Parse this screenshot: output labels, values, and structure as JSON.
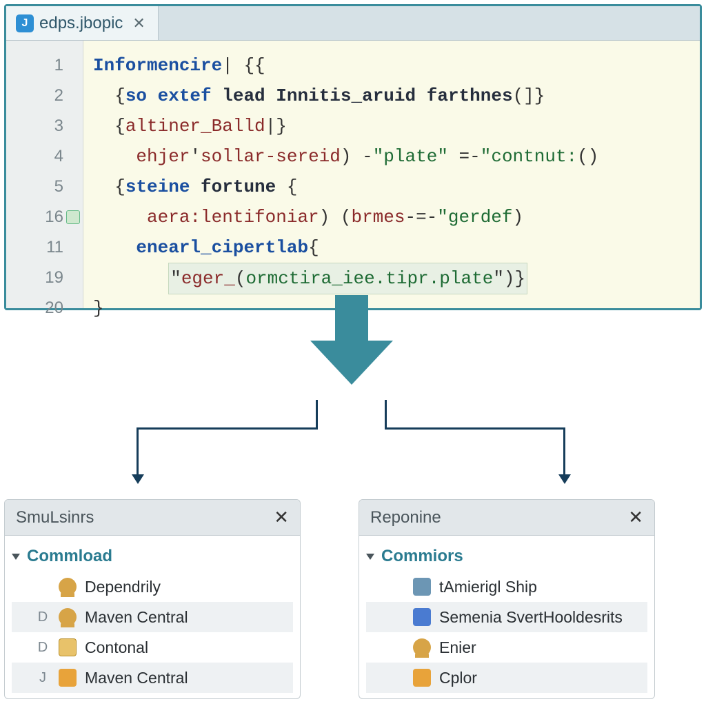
{
  "editor": {
    "tab": {
      "filename": "edps.jbopic"
    },
    "lines": [
      {
        "num": "1",
        "tokens": [
          [
            "kw",
            "Informencire"
          ],
          [
            "pl",
            "| {{"
          ]
        ]
      },
      {
        "num": "2",
        "tokens": [
          [
            "pl",
            "  {"
          ],
          [
            "kw",
            "so extef"
          ],
          [
            "pl",
            " "
          ],
          [
            "nm",
            "lead"
          ],
          [
            "pl",
            " "
          ],
          [
            "nm",
            "Innitis_aruid"
          ],
          [
            "pl",
            " "
          ],
          [
            "nm",
            "farthnes"
          ],
          [
            "pl",
            "(]}"
          ]
        ]
      },
      {
        "num": "3",
        "tokens": [
          [
            "pl",
            "  {"
          ],
          [
            "mt",
            "altiner_Balld"
          ],
          [
            "pl",
            "|}"
          ]
        ]
      },
      {
        "num": "4",
        "tokens": [
          [
            "pl",
            "    "
          ],
          [
            "mt",
            "ehjer"
          ],
          [
            "pl",
            "'"
          ],
          [
            "mt",
            "sollar-sereid"
          ],
          [
            "pl",
            ") -"
          ],
          [
            "st",
            "\"plate\""
          ],
          [
            "pl",
            " =-"
          ],
          [
            "st",
            "\"contnut:"
          ],
          [
            "pl",
            "()"
          ]
        ]
      },
      {
        "num": "5",
        "tokens": [
          [
            "pl",
            "  {"
          ],
          [
            "kw",
            "steine"
          ],
          [
            "pl",
            " "
          ],
          [
            "nm",
            "fortune"
          ],
          [
            "pl",
            " {"
          ]
        ]
      },
      {
        "num": "16",
        "tokens": [
          [
            "pl",
            "     "
          ],
          [
            "mt",
            "aera:lentifoniar"
          ],
          [
            "pl",
            ") ("
          ],
          [
            "mt",
            "brmes"
          ],
          [
            "pl",
            "-=-"
          ],
          [
            "st",
            "\"gerdef"
          ],
          [
            "pl",
            ")"
          ]
        ],
        "mark": true
      },
      {
        "num": "11",
        "tokens": [
          [
            "pl",
            "    "
          ],
          [
            "kw",
            "enearl_cipertlab"
          ],
          [
            "pl",
            "{"
          ]
        ]
      },
      {
        "num": "19",
        "tokens_hl": [
          [
            "pl",
            "\""
          ],
          [
            "mt",
            "eger_"
          ],
          [
            "pl",
            "("
          ],
          [
            "st",
            "ormctira_iee.tipr.plate"
          ],
          [
            "pl",
            "\")}"
          ]
        ],
        "indent": "       "
      },
      {
        "num": "20",
        "tokens": [
          [
            "pl",
            "}"
          ]
        ]
      }
    ]
  },
  "panels": {
    "left": {
      "title": "SmuLsinrs",
      "root": "Commload",
      "items": [
        {
          "badge": "",
          "icon": "person",
          "label": "Dependrily"
        },
        {
          "badge": "D",
          "icon": "person",
          "label": "Maven Central"
        },
        {
          "badge": "D",
          "icon": "doc",
          "label": "Contonal"
        },
        {
          "badge": "J",
          "icon": "folder",
          "label": "Maven Central"
        }
      ]
    },
    "right": {
      "title": "Reponine",
      "root": "Commiors",
      "items": [
        {
          "badge": "",
          "icon": "db",
          "label": "tAmierigl Ship"
        },
        {
          "badge": "",
          "icon": "card",
          "label": "Semenia SvertHooldesrits"
        },
        {
          "badge": "",
          "icon": "person",
          "label": "Enier"
        },
        {
          "badge": "",
          "icon": "folder",
          "label": "Cplor"
        }
      ]
    }
  }
}
